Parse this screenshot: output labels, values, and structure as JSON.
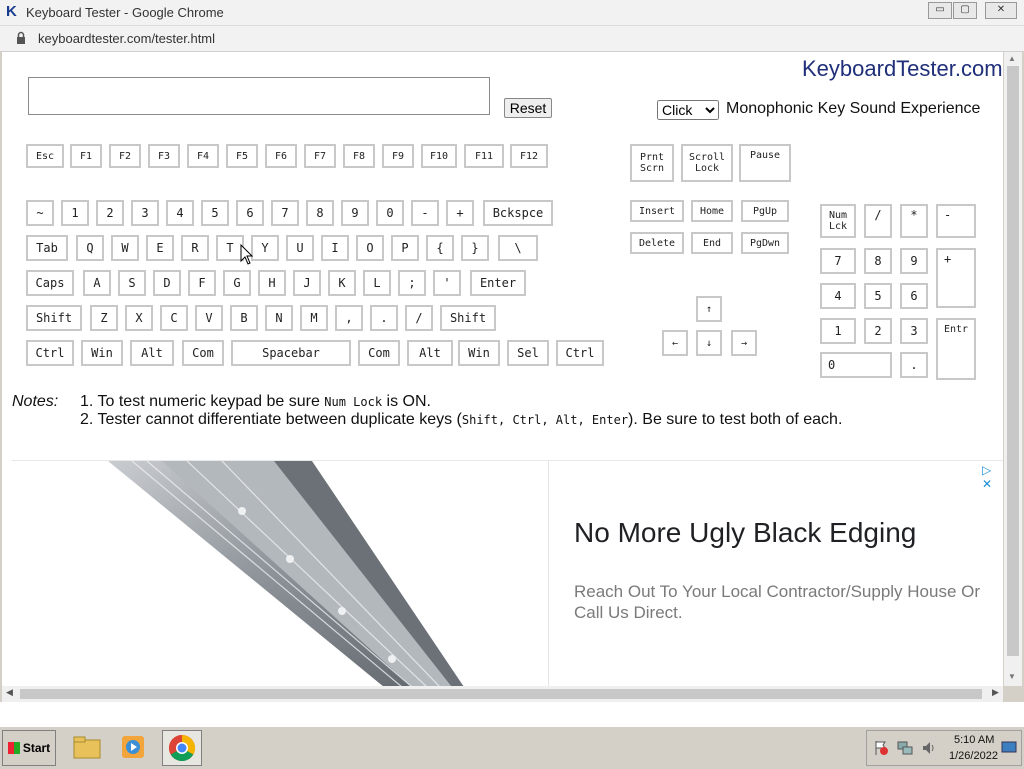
{
  "window": {
    "title": "Keyboard Tester - Google Chrome",
    "minimize": "▭",
    "maximize": "▢",
    "close": "✕",
    "address": "keyboardtester.com/tester.html"
  },
  "page": {
    "brand": "KeyboardTester.com",
    "input_value": "",
    "reset_label": "Reset",
    "sound_options": [
      "Click"
    ],
    "sound_selected": "Click",
    "sound_label": "Monophonic Key Sound Experience"
  },
  "keys": {
    "esc": "Esc",
    "f1": "F1",
    "f2": "F2",
    "f3": "F3",
    "f4": "F4",
    "f5": "F5",
    "f6": "F6",
    "f7": "F7",
    "f8": "F8",
    "f9": "F9",
    "f10": "F10",
    "f11": "F11",
    "f12": "F12",
    "prnt_1": "Prnt",
    "prnt_2": "Scrn",
    "scroll_1": "Scroll",
    "scroll_2": "Lock",
    "pause": "Pause",
    "tilde": "~",
    "d1": "1",
    "d2": "2",
    "d3": "3",
    "d4": "4",
    "d5": "5",
    "d6": "6",
    "d7": "7",
    "d8": "8",
    "d9": "9",
    "d0": "0",
    "minus": "-",
    "plus": "+",
    "bksp": "Bckspce",
    "tab": "Tab",
    "q": "Q",
    "w": "W",
    "e": "E",
    "r": "R",
    "t": "T",
    "y": "Y",
    "u": "U",
    "i": "I",
    "o": "O",
    "p": "P",
    "lbrace": "{",
    "rbrace": "}",
    "bslash": "\\",
    "caps": "Caps",
    "a": "A",
    "s": "S",
    "d": "D",
    "f": "F",
    "g": "G",
    "h": "H",
    "j": "J",
    "k": "K",
    "l": "L",
    "semi": ";",
    "quote": "'",
    "enter": "Enter",
    "shift": "Shift",
    "z": "Z",
    "x": "X",
    "c": "C",
    "v": "V",
    "b": "B",
    "n": "N",
    "m": "M",
    "comma": ",",
    "period": ".",
    "slash": "/",
    "ctrl": "Ctrl",
    "win": "Win",
    "alt": "Alt",
    "com": "Com",
    "space": "Spacebar",
    "sel": "Sel",
    "insert": "Insert",
    "home": "Home",
    "pgup": "PgUp",
    "delete": "Delete",
    "end": "End",
    "pgdwn": "PgDwn",
    "up": "↑",
    "left": "←",
    "down": "↓",
    "right": "→",
    "numlk_1": "Num",
    "numlk_2": "Lck",
    "np_div": "/",
    "np_mul": "*",
    "np_sub": "-",
    "np7": "7",
    "np8": "8",
    "np9": "9",
    "np_add": "+",
    "np4": "4",
    "np5": "5",
    "np6": "6",
    "np1": "1",
    "np2": "2",
    "np3": "3",
    "np_enter": "Entr",
    "np0": "0",
    "np_dot": "."
  },
  "notes": {
    "label": "Notes:",
    "n1_a": "1. To test numeric keypad be sure ",
    "n1_code": "Num Lock",
    "n1_b": " is ON.",
    "n2_a": "2. Tester cannot differentiate between duplicate keys (",
    "n2_code": "Shift, Ctrl, Alt, Enter",
    "n2_b": "). Be sure to test both of each."
  },
  "ad": {
    "headline": "No More Ugly Black Edging",
    "body": "Reach Out To Your Local Contractor/Supply House Or Call Us Direct.",
    "choices": "▷ ✕"
  },
  "taskbar": {
    "start": "Start",
    "time": "5:10 AM",
    "date": "1/26/2022"
  }
}
